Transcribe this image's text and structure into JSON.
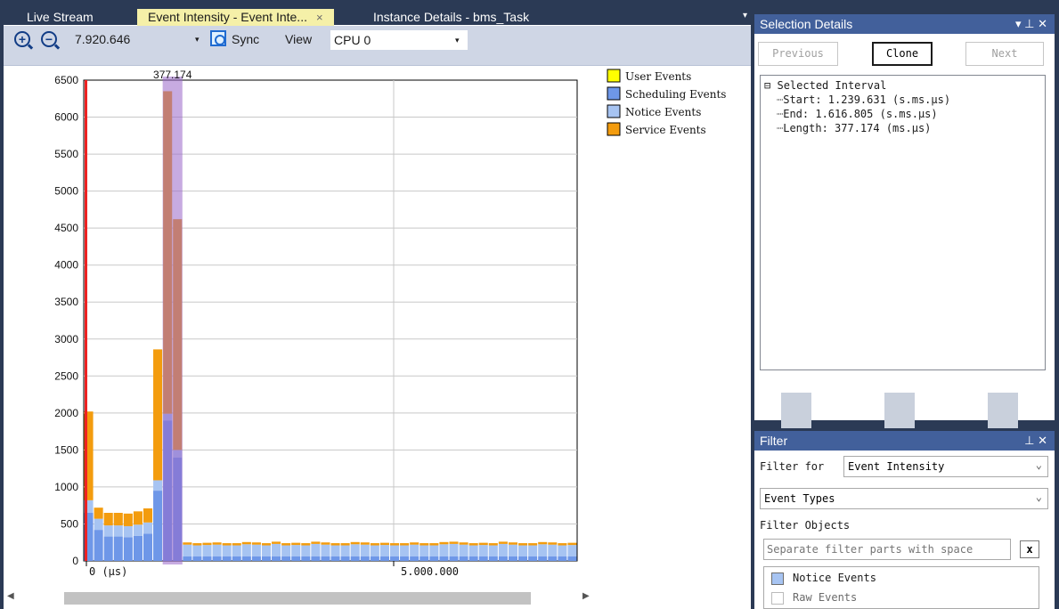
{
  "tabs": [
    {
      "label": "Live Stream",
      "active": false
    },
    {
      "label": "Event Intensity - Event Inte...",
      "active": true,
      "close": "×"
    },
    {
      "label": "Instance Details - bms_Task",
      "active": false
    }
  ],
  "tab_menu_icon": "▾",
  "toolbar": {
    "zoom_in_icon": "+",
    "zoom_out_icon": "−",
    "zoom_value": "7.920.646",
    "dropdown_arrow": "▾",
    "sync_label": "Sync",
    "view_label": "View",
    "cpu_value": "CPU 0",
    "cpu_arrow": "▾"
  },
  "colors": {
    "user": "#ffff00",
    "scheduling": "#6e97e8",
    "notice": "#a7c4f2",
    "service": "#f39c0e",
    "selection": "#9966c8",
    "marker": "#ee2222"
  },
  "chart_data": {
    "type": "bar",
    "ylim": [
      0,
      6500
    ],
    "yticks": [
      "0",
      "500",
      "1000",
      "1500",
      "2000",
      "2500",
      "3000",
      "3500",
      "4000",
      "4500",
      "5000",
      "5500",
      "6000",
      "6500"
    ],
    "xticks": [
      "0 (µs)",
      "5.000.000"
    ],
    "selection_label": "377.174",
    "legend": [
      "User Events",
      "Scheduling Events",
      "Notice Events",
      "Service Events"
    ],
    "bars": [
      {
        "scheduling": 650,
        "notice": 170,
        "service": 1200
      },
      {
        "scheduling": 420,
        "notice": 150,
        "service": 150
      },
      {
        "scheduling": 330,
        "notice": 150,
        "service": 170
      },
      {
        "scheduling": 330,
        "notice": 150,
        "service": 170
      },
      {
        "scheduling": 320,
        "notice": 150,
        "service": 170
      },
      {
        "scheduling": 340,
        "notice": 150,
        "service": 180
      },
      {
        "scheduling": 370,
        "notice": 150,
        "service": 190
      },
      {
        "scheduling": 950,
        "notice": 140,
        "service": 1770
      },
      {
        "scheduling": 1900,
        "notice": 90,
        "service": 4360
      },
      {
        "scheduling": 1400,
        "notice": 100,
        "service": 3120
      },
      {
        "scheduling": 60,
        "notice": 160,
        "service": 30
      },
      {
        "scheduling": 60,
        "notice": 150,
        "service": 30
      },
      {
        "scheduling": 60,
        "notice": 155,
        "service": 30
      },
      {
        "scheduling": 60,
        "notice": 160,
        "service": 30
      },
      {
        "scheduling": 60,
        "notice": 150,
        "service": 30
      },
      {
        "scheduling": 60,
        "notice": 150,
        "service": 30
      },
      {
        "scheduling": 60,
        "notice": 165,
        "service": 30
      },
      {
        "scheduling": 60,
        "notice": 160,
        "service": 30
      },
      {
        "scheduling": 60,
        "notice": 150,
        "service": 30
      },
      {
        "scheduling": 60,
        "notice": 170,
        "service": 30
      },
      {
        "scheduling": 60,
        "notice": 150,
        "service": 30
      },
      {
        "scheduling": 60,
        "notice": 155,
        "service": 30
      },
      {
        "scheduling": 60,
        "notice": 150,
        "service": 30
      },
      {
        "scheduling": 60,
        "notice": 170,
        "service": 30
      },
      {
        "scheduling": 60,
        "notice": 160,
        "service": 30
      },
      {
        "scheduling": 60,
        "notice": 150,
        "service": 30
      },
      {
        "scheduling": 60,
        "notice": 150,
        "service": 30
      },
      {
        "scheduling": 60,
        "notice": 165,
        "service": 30
      },
      {
        "scheduling": 60,
        "notice": 160,
        "service": 30
      },
      {
        "scheduling": 60,
        "notice": 150,
        "service": 30
      },
      {
        "scheduling": 60,
        "notice": 155,
        "service": 30
      },
      {
        "scheduling": 60,
        "notice": 150,
        "service": 30
      },
      {
        "scheduling": 60,
        "notice": 150,
        "service": 30
      },
      {
        "scheduling": 60,
        "notice": 160,
        "service": 30
      },
      {
        "scheduling": 60,
        "notice": 150,
        "service": 30
      },
      {
        "scheduling": 60,
        "notice": 150,
        "service": 30
      },
      {
        "scheduling": 60,
        "notice": 165,
        "service": 30
      },
      {
        "scheduling": 60,
        "notice": 170,
        "service": 30
      },
      {
        "scheduling": 60,
        "notice": 160,
        "service": 30
      },
      {
        "scheduling": 60,
        "notice": 150,
        "service": 30
      },
      {
        "scheduling": 60,
        "notice": 155,
        "service": 30
      },
      {
        "scheduling": 60,
        "notice": 150,
        "service": 30
      },
      {
        "scheduling": 60,
        "notice": 170,
        "service": 30
      },
      {
        "scheduling": 60,
        "notice": 160,
        "service": 30
      },
      {
        "scheduling": 60,
        "notice": 150,
        "service": 30
      },
      {
        "scheduling": 60,
        "notice": 150,
        "service": 30
      },
      {
        "scheduling": 60,
        "notice": 165,
        "service": 30
      },
      {
        "scheduling": 60,
        "notice": 160,
        "service": 30
      },
      {
        "scheduling": 60,
        "notice": 150,
        "service": 30
      },
      {
        "scheduling": 60,
        "notice": 155,
        "service": 30
      }
    ]
  },
  "selection_details": {
    "title": "Selection Details",
    "controls": "▾ ⊥ ✕",
    "previous": "Previous",
    "clone": "Clone",
    "next": "Next",
    "tree": {
      "root": "Selected Interval",
      "start": "Start: 1.239.631 (s.ms.µs)",
      "end": "End: 1.616.805 (s.ms.µs)",
      "length": "Length: 377.174 (ms.µs)"
    }
  },
  "filter": {
    "title": "Filter",
    "controls": "⊥ ✕",
    "filter_for_label": "Filter for",
    "filter_for_value": "Event Intensity",
    "event_types_value": "Event Types",
    "filter_objects_label": "Filter Objects",
    "placeholder": "Separate filter parts with space",
    "clear_button": "x",
    "items": [
      "Notice Events",
      "Raw Events"
    ],
    "chevron": "⌄"
  }
}
